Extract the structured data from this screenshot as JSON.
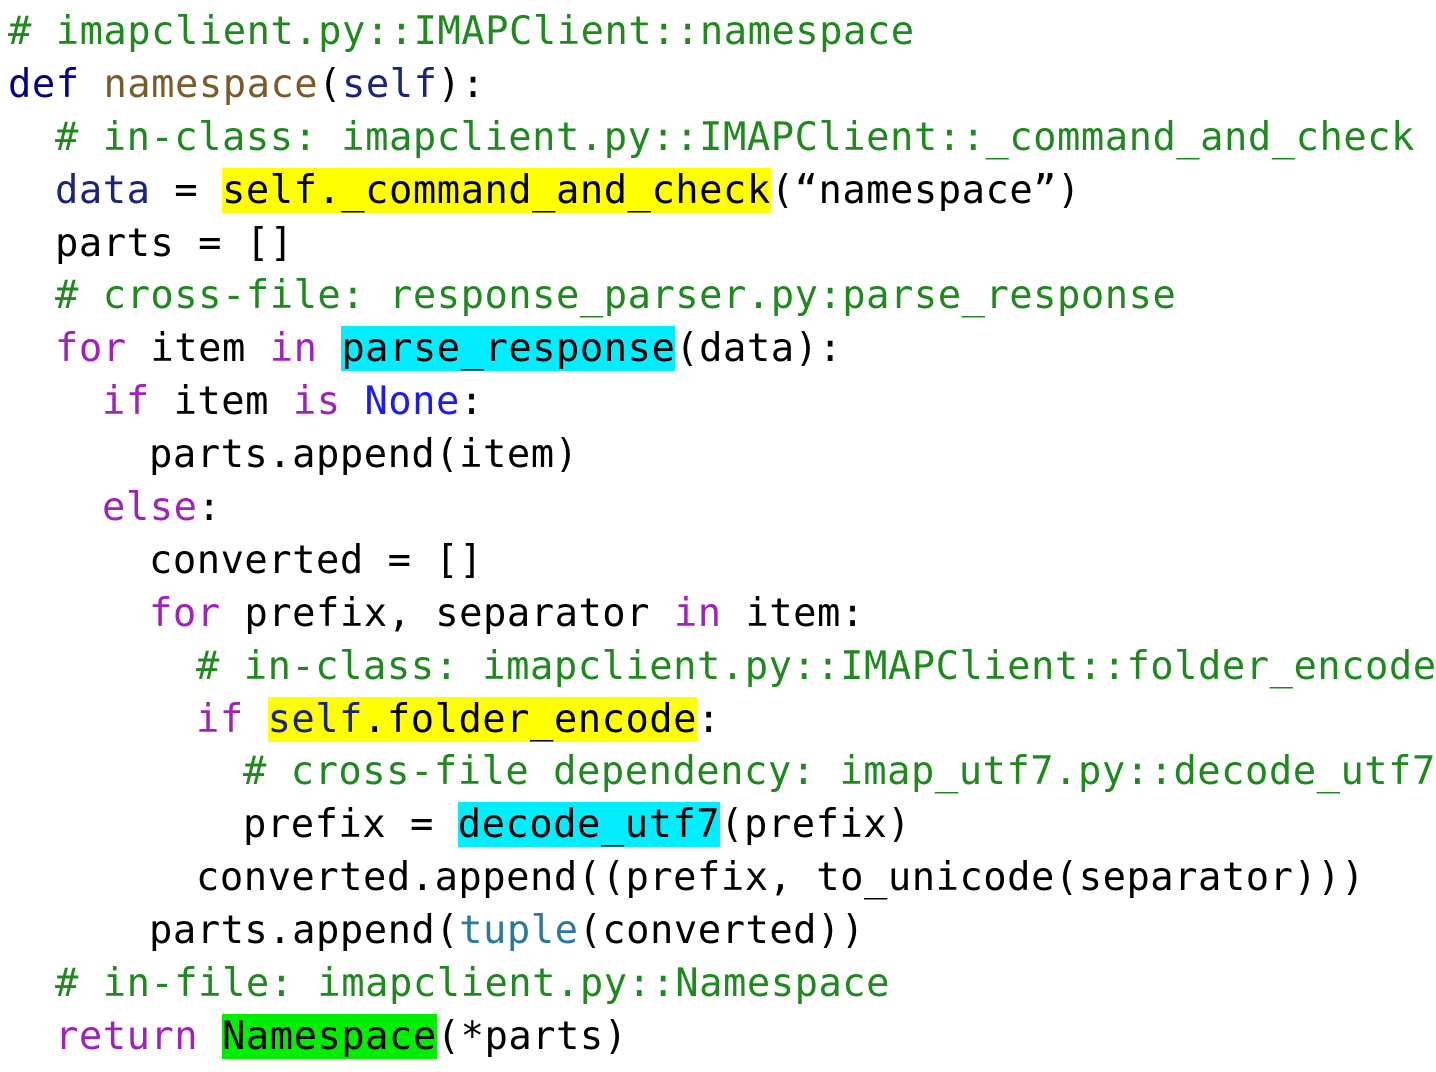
{
  "colors": {
    "comment": "#1e8a1e",
    "keyword": "#a020c0",
    "def_keyword": "#00008b",
    "function_name": "#7a5c2a",
    "self": "#1a237e",
    "none": "#1a1aff",
    "builtin": "#2a7a9a",
    "default": "#000000",
    "hl_in_class": "#ffff00",
    "hl_cross_file": "#00eeff",
    "hl_in_file": "#00ee00"
  },
  "lines": [
    {
      "indent": 0,
      "tokens": [
        {
          "t": "# imapclient.py::IMAPClient::namespace",
          "c": "comment"
        }
      ]
    },
    {
      "indent": 0,
      "tokens": [
        {
          "t": "def",
          "c": "def_keyword"
        },
        {
          "t": " ",
          "c": "default"
        },
        {
          "t": "namespace",
          "c": "function_name"
        },
        {
          "t": "(",
          "c": "default"
        },
        {
          "t": "self",
          "c": "self"
        },
        {
          "t": "):",
          "c": "default"
        }
      ]
    },
    {
      "indent": 1,
      "tokens": [
        {
          "t": "# in-class: imapclient.py::IMAPClient::_command_and_check",
          "c": "comment"
        }
      ]
    },
    {
      "indent": 1,
      "tokens": [
        {
          "t": "data",
          "c": "self"
        },
        {
          "t": " = ",
          "c": "default"
        },
        {
          "t": "self._command_and_check",
          "c": "default",
          "hl": "hl_in_class"
        },
        {
          "t": "(“namespace”)",
          "c": "default"
        }
      ]
    },
    {
      "indent": 1,
      "tokens": [
        {
          "t": "parts = []",
          "c": "default"
        }
      ]
    },
    {
      "indent": 1,
      "tokens": [
        {
          "t": "# cross-file: response_parser.py:parse_response",
          "c": "comment"
        }
      ]
    },
    {
      "indent": 1,
      "tokens": [
        {
          "t": "for",
          "c": "keyword"
        },
        {
          "t": " item ",
          "c": "default"
        },
        {
          "t": "in",
          "c": "keyword"
        },
        {
          "t": " ",
          "c": "default"
        },
        {
          "t": "parse_response",
          "c": "default",
          "hl": "hl_cross_file"
        },
        {
          "t": "(data):",
          "c": "default"
        }
      ]
    },
    {
      "indent": 2,
      "tokens": [
        {
          "t": "if",
          "c": "keyword"
        },
        {
          "t": " item ",
          "c": "default"
        },
        {
          "t": "is",
          "c": "keyword"
        },
        {
          "t": " ",
          "c": "default"
        },
        {
          "t": "None",
          "c": "none"
        },
        {
          "t": ":",
          "c": "default"
        }
      ]
    },
    {
      "indent": 3,
      "tokens": [
        {
          "t": "parts.append(item)",
          "c": "default"
        }
      ]
    },
    {
      "indent": 2,
      "tokens": [
        {
          "t": "else",
          "c": "keyword"
        },
        {
          "t": ":",
          "c": "default"
        }
      ]
    },
    {
      "indent": 3,
      "tokens": [
        {
          "t": "converted = []",
          "c": "default"
        }
      ]
    },
    {
      "indent": 3,
      "tokens": [
        {
          "t": "for",
          "c": "keyword"
        },
        {
          "t": " prefix, separator ",
          "c": "default"
        },
        {
          "t": "in",
          "c": "keyword"
        },
        {
          "t": " item:",
          "c": "default"
        }
      ]
    },
    {
      "indent": 4,
      "tokens": [
        {
          "t": "# in-class: imapclient.py::IMAPClient::folder_encode",
          "c": "comment"
        }
      ]
    },
    {
      "indent": 4,
      "tokens": [
        {
          "t": "if",
          "c": "keyword"
        },
        {
          "t": " ",
          "c": "default"
        },
        {
          "t": "self",
          "c": "self",
          "hl": "hl_in_class"
        },
        {
          "t": ".folder_encode",
          "c": "default",
          "hl": "hl_in_class"
        },
        {
          "t": ":",
          "c": "default"
        }
      ]
    },
    {
      "indent": 5,
      "tokens": [
        {
          "t": "# cross-file dependency: imap_utf7.py::decode_utf7",
          "c": "comment"
        }
      ]
    },
    {
      "indent": 5,
      "tokens": [
        {
          "t": "prefix = ",
          "c": "default"
        },
        {
          "t": "decode_utf7",
          "c": "default",
          "hl": "hl_cross_file"
        },
        {
          "t": "(prefix)",
          "c": "default"
        }
      ]
    },
    {
      "indent": 4,
      "tokens": [
        {
          "t": "converted.append((prefix, to_unicode(separator)))",
          "c": "default"
        }
      ]
    },
    {
      "indent": 3,
      "tokens": [
        {
          "t": "parts.append(",
          "c": "default"
        },
        {
          "t": "tuple",
          "c": "builtin"
        },
        {
          "t": "(converted))",
          "c": "default"
        }
      ]
    },
    {
      "indent": 1,
      "tokens": [
        {
          "t": "# in-file: imapclient.py::Namespace",
          "c": "comment"
        }
      ]
    },
    {
      "indent": 1,
      "tokens": [
        {
          "t": "return",
          "c": "keyword"
        },
        {
          "t": " ",
          "c": "default"
        },
        {
          "t": "Namespace",
          "c": "default",
          "hl": "hl_in_file"
        },
        {
          "t": "(*parts)",
          "c": "default"
        }
      ]
    }
  ]
}
